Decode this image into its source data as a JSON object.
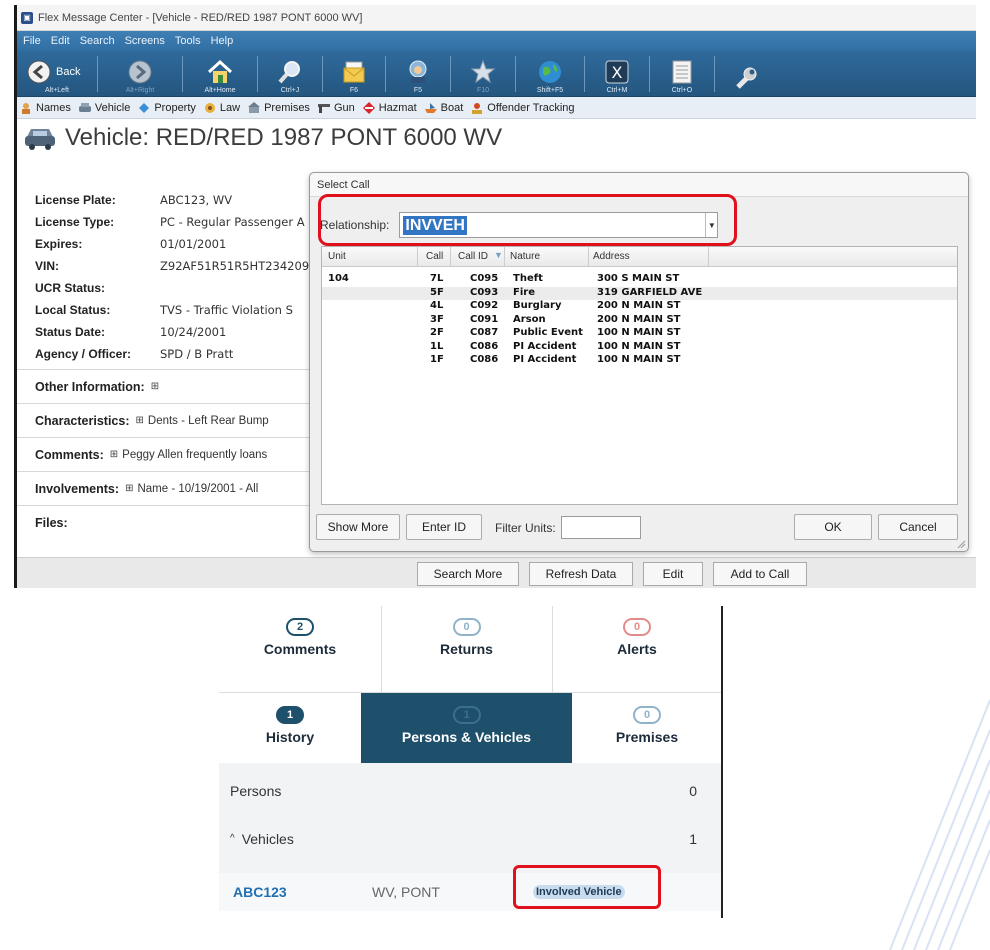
{
  "window": {
    "title": "Flex Message Center - [Vehicle - RED/RED 1987 PONT 6000 WV]",
    "menu": [
      "File",
      "Edit",
      "Search",
      "Screens",
      "Tools",
      "Help"
    ],
    "toolbar": [
      {
        "label": "Alt+Left",
        "name": "Back",
        "icon": "back-arrow-icon"
      },
      {
        "label": "Alt+Right",
        "name": "",
        "icon": "forward-arrow-icon"
      },
      {
        "label": "Alt+Home",
        "name": "",
        "icon": "home-icon"
      },
      {
        "label": "Ctrl+J",
        "name": "",
        "icon": "search-magnifier-icon"
      },
      {
        "label": "F6",
        "name": "",
        "icon": "message-icon"
      },
      {
        "label": "F5",
        "name": "",
        "icon": "officer-icon"
      },
      {
        "label": "F10",
        "name": "",
        "icon": "star-icon"
      },
      {
        "label": "Shift+F5",
        "name": "",
        "icon": "globe-icon"
      },
      {
        "label": "Ctrl+M",
        "name": "",
        "icon": "excel-icon"
      },
      {
        "label": "Ctrl+O",
        "name": "",
        "icon": "form-icon"
      },
      {
        "label": "",
        "name": "",
        "icon": "wrench-icon"
      }
    ],
    "links": [
      "Names",
      "Vehicle",
      "Property",
      "Law",
      "Premises",
      "Gun",
      "Hazmat",
      "Boat",
      "Offender Tracking"
    ],
    "page_title": "Vehicle: RED/RED 1987 PONT 6000 WV"
  },
  "details": {
    "fields": [
      {
        "key": "License Plate:",
        "value": "ABC123, WV"
      },
      {
        "key": "License Type:",
        "value": "PC - Regular Passenger A"
      },
      {
        "key": "Expires:",
        "value": "01/01/2001"
      },
      {
        "key": "VIN:",
        "value": "Z92AF51R51R5HT234209"
      },
      {
        "key": "UCR Status:",
        "value": ""
      },
      {
        "key": "Local Status:",
        "value": "TVS - Traffic Violation S"
      },
      {
        "key": "Status Date:",
        "value": "10/24/2001"
      },
      {
        "key": "Agency / Officer:",
        "value": "SPD / B Pratt"
      }
    ],
    "sections": [
      {
        "key": "Other Information:",
        "plus": "⊞",
        "value": ""
      },
      {
        "key": "Characteristics:",
        "plus": "⊞",
        "value": "Dents - Left Rear Bump"
      },
      {
        "key": "Comments:",
        "plus": "⊞",
        "value": "Peggy Allen frequently loans"
      },
      {
        "key": "Involvements:",
        "plus": "⊞",
        "value": "Name - 10/19/2001 - All"
      },
      {
        "key": "Files:",
        "plus": "",
        "value": ""
      }
    ]
  },
  "bottom_buttons": [
    "Search More",
    "Refresh Data",
    "Edit",
    "Add to Call"
  ],
  "dialog": {
    "title": "Select Call",
    "relationship_label": "Relationship:",
    "relationship_value": "INVVEH",
    "columns": [
      "Unit",
      "Call",
      "Call ID",
      "Nature",
      "Address"
    ],
    "rows": [
      {
        "unit": "104",
        "call": "7L",
        "call_id": "C095",
        "nature": "Theft",
        "address": "300 S MAIN ST"
      },
      {
        "unit": "",
        "call": "5F",
        "call_id": "C093",
        "nature": "Fire",
        "address": "319 GARFIELD AVE"
      },
      {
        "unit": "",
        "call": "4L",
        "call_id": "C092",
        "nature": "Burglary",
        "address": "200 N MAIN ST"
      },
      {
        "unit": "",
        "call": "3F",
        "call_id": "C091",
        "nature": "Arson",
        "address": "200 N MAIN ST"
      },
      {
        "unit": "",
        "call": "2F",
        "call_id": "C087",
        "nature": "Public Event",
        "address": "100 N MAIN ST"
      },
      {
        "unit": "",
        "call": "1L",
        "call_id": "C086",
        "nature": "PI Accident",
        "address": "100 N MAIN ST"
      },
      {
        "unit": "",
        "call": "1F",
        "call_id": "C086",
        "nature": "PI Accident",
        "address": "100 N MAIN ST"
      }
    ],
    "show_more": "Show More",
    "enter_id": "Enter ID",
    "filter_label": "Filter Units:",
    "filter_value": "",
    "ok": "OK",
    "cancel": "Cancel"
  },
  "panel": {
    "tabs": [
      {
        "label": "Comments",
        "count": "2",
        "color": "#1e4f6b"
      },
      {
        "label": "Returns",
        "count": "0",
        "color": "#8fb3c8"
      },
      {
        "label": "Alerts",
        "count": "0",
        "color": "#e58a8a"
      },
      {
        "label": "History",
        "count": "1",
        "color": "#1e4f6b"
      },
      {
        "label": "Persons & Vehicles",
        "count": "1",
        "color": "#3a6f8d"
      },
      {
        "label": "Premises",
        "count": "0",
        "color": "#8fb3c8"
      }
    ],
    "persons_label": "Persons",
    "persons_count": "0",
    "vehicles_label": "Vehicles",
    "vehicles_count": "1",
    "vehicle": {
      "plate": "ABC123",
      "desc": "WV, PONT",
      "tag": "Involved Vehicle"
    }
  },
  "colors": {
    "highlight_red": "#e0101c",
    "selection_blue": "#3276c3",
    "panel_dark": "#1e4f6b"
  }
}
